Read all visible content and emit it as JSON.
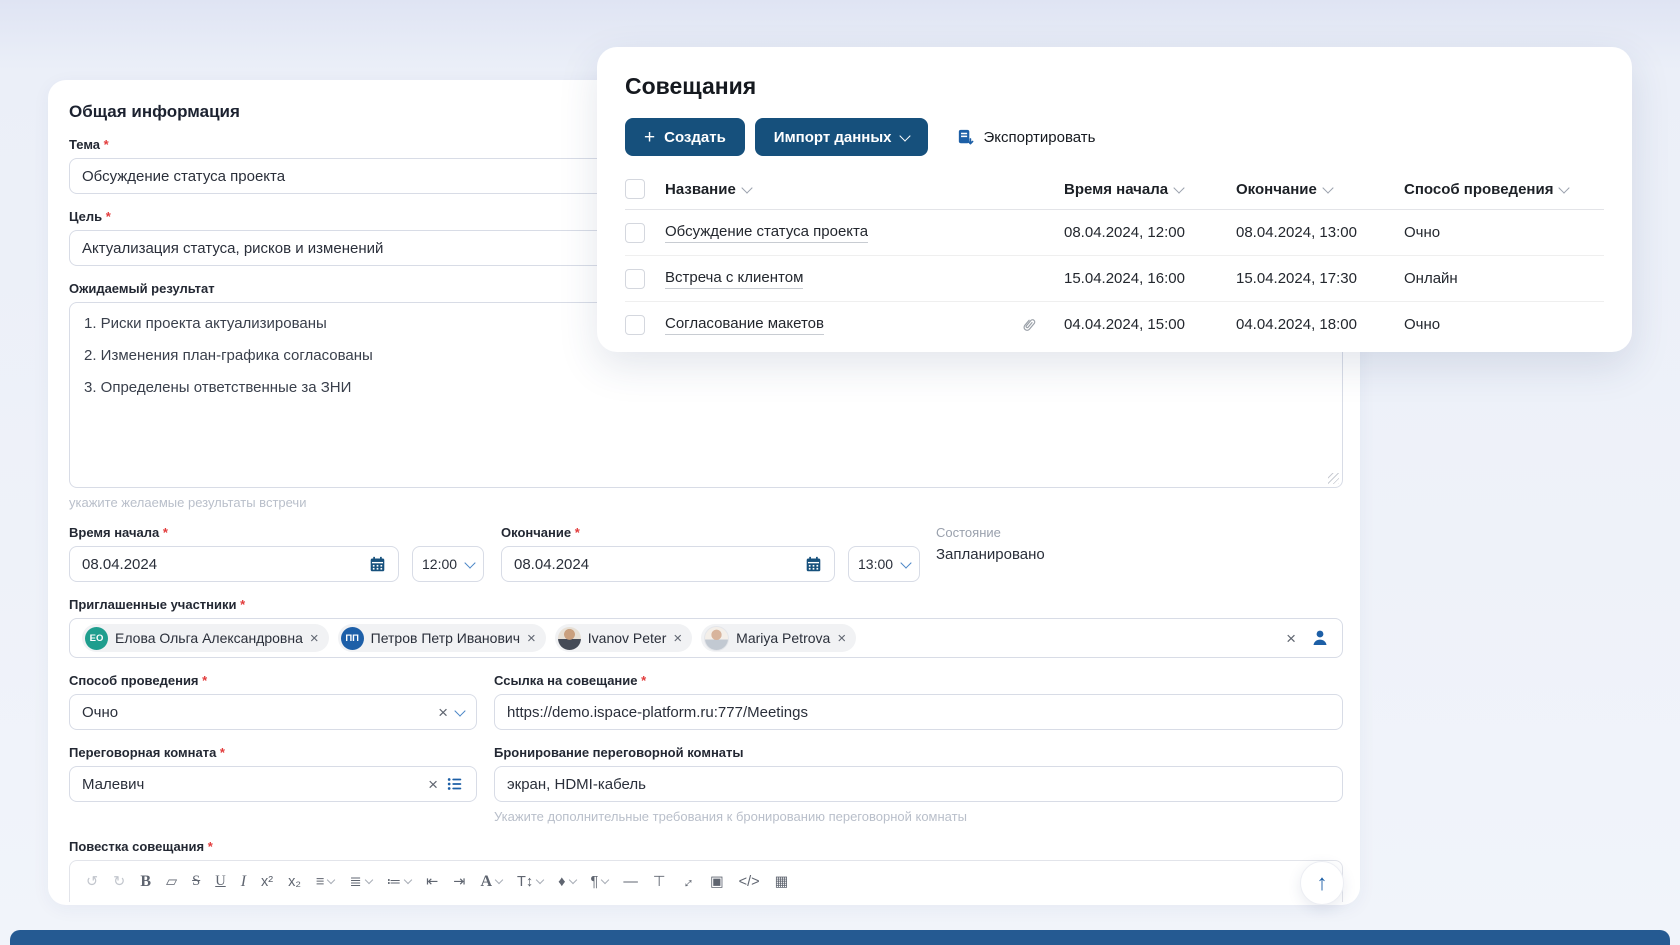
{
  "page": {
    "background": "#eef1f9",
    "accent_blue": "#16507c",
    "link_blue": "#1d5fa6",
    "danger_red": "#e23b3b",
    "bottom_bar_color": "#255a92",
    "up_arrow": "↑"
  },
  "meetings_panel": {
    "title": "Совещания",
    "toolbar": {
      "create": "Создать",
      "create_plus": "+",
      "import": "Импорт данных",
      "export": "Экспортировать"
    },
    "table": {
      "columns": [
        "Название",
        "Время начала",
        "Окончание",
        "Способ проведения"
      ],
      "rows": [
        {
          "name": "Обсуждение статуса проекта",
          "start": "08.04.2024, 12:00",
          "end": "08.04.2024, 13:00",
          "method": "Очно",
          "has_attachment": false
        },
        {
          "name": "Встреча с клиентом",
          "start": "15.04.2024, 16:00",
          "end": "15.04.2024, 17:30",
          "method": "Онлайн",
          "has_attachment": false
        },
        {
          "name": "Согласование макетов",
          "start": "04.04.2024, 15:00",
          "end": "04.04.2024, 18:00",
          "method": "Очно",
          "has_attachment": true
        }
      ]
    }
  },
  "form_panel": {
    "title": "Общая информация",
    "topic": {
      "label": "Тема",
      "value": "Обсуждение статуса проекта"
    },
    "goal": {
      "label": "Цель",
      "value": "Актуализация статуса, рисков и изменений"
    },
    "expected_result": {
      "label": "Ожидаемый результат",
      "lines": [
        "1. Риски проекта актуализированы",
        "2. Изменения план-графика согласованы",
        "3. Определены ответственные за ЗНИ"
      ],
      "hint": "укажите желаемые результаты встречи"
    },
    "start_time": {
      "label": "Время начала",
      "date": "08.04.2024",
      "time": "12:00"
    },
    "end_time": {
      "label": "Окончание",
      "date": "08.04.2024",
      "time": "13:00"
    },
    "status": {
      "label": "Состояние",
      "value": "Запланировано"
    },
    "participants": {
      "label": "Приглашенные участники",
      "chips": [
        {
          "initials": "ЕО",
          "name": "Елова Ольга Александровна",
          "avatar_color": "#1f9e8e"
        },
        {
          "initials": "ПП",
          "name": "Петров Петр Иванович",
          "avatar_color": "#1d5fa8"
        },
        {
          "name": "Ivanov Peter"
        },
        {
          "name": "Mariya Petrova"
        }
      ]
    },
    "method": {
      "label": "Способ проведения",
      "value": "Очно"
    },
    "link": {
      "label": "Ссылка на совещание",
      "value": "https://demo.ispace-platform.ru:777/Meetings"
    },
    "room": {
      "label": "Переговорная комната",
      "value": "Малевич"
    },
    "booking": {
      "label": "Бронирование переговорной комнаты",
      "value": "экран, HDMI-кабель",
      "hint": "Укажите дополнительные требования к бронированию переговорной комнаты"
    },
    "agenda": {
      "label": "Повестка совещания",
      "toolbar": [
        {
          "name": "undo",
          "glyph": "↺"
        },
        {
          "name": "redo",
          "glyph": "↻"
        },
        {
          "name": "bold",
          "glyph": "B"
        },
        {
          "name": "eraser",
          "glyph": "▱"
        },
        {
          "name": "strikethrough",
          "glyph": "S"
        },
        {
          "name": "underline",
          "glyph": "U"
        },
        {
          "name": "italic",
          "glyph": "I"
        },
        {
          "name": "superscript",
          "glyph": "x²"
        },
        {
          "name": "subscript",
          "glyph": "x₂"
        },
        {
          "name": "align",
          "glyph": "≡"
        },
        {
          "name": "bullet-list",
          "glyph": "≣"
        },
        {
          "name": "numbered-list",
          "glyph": "≔"
        },
        {
          "name": "outdent",
          "glyph": "⇤"
        },
        {
          "name": "indent",
          "glyph": "⇥"
        },
        {
          "name": "font-color",
          "glyph": "A"
        },
        {
          "name": "font-size",
          "glyph": "T↕"
        },
        {
          "name": "ink-color",
          "glyph": "♦"
        },
        {
          "name": "paragraph",
          "glyph": "¶"
        },
        {
          "name": "horizontal-rule",
          "glyph": "—"
        },
        {
          "name": "clear-format",
          "glyph": "⊤"
        },
        {
          "name": "fullscreen",
          "glyph": "↔"
        },
        {
          "name": "image",
          "glyph": "▣"
        },
        {
          "name": "code",
          "glyph": "</>"
        },
        {
          "name": "table",
          "glyph": "▦"
        }
      ]
    }
  }
}
